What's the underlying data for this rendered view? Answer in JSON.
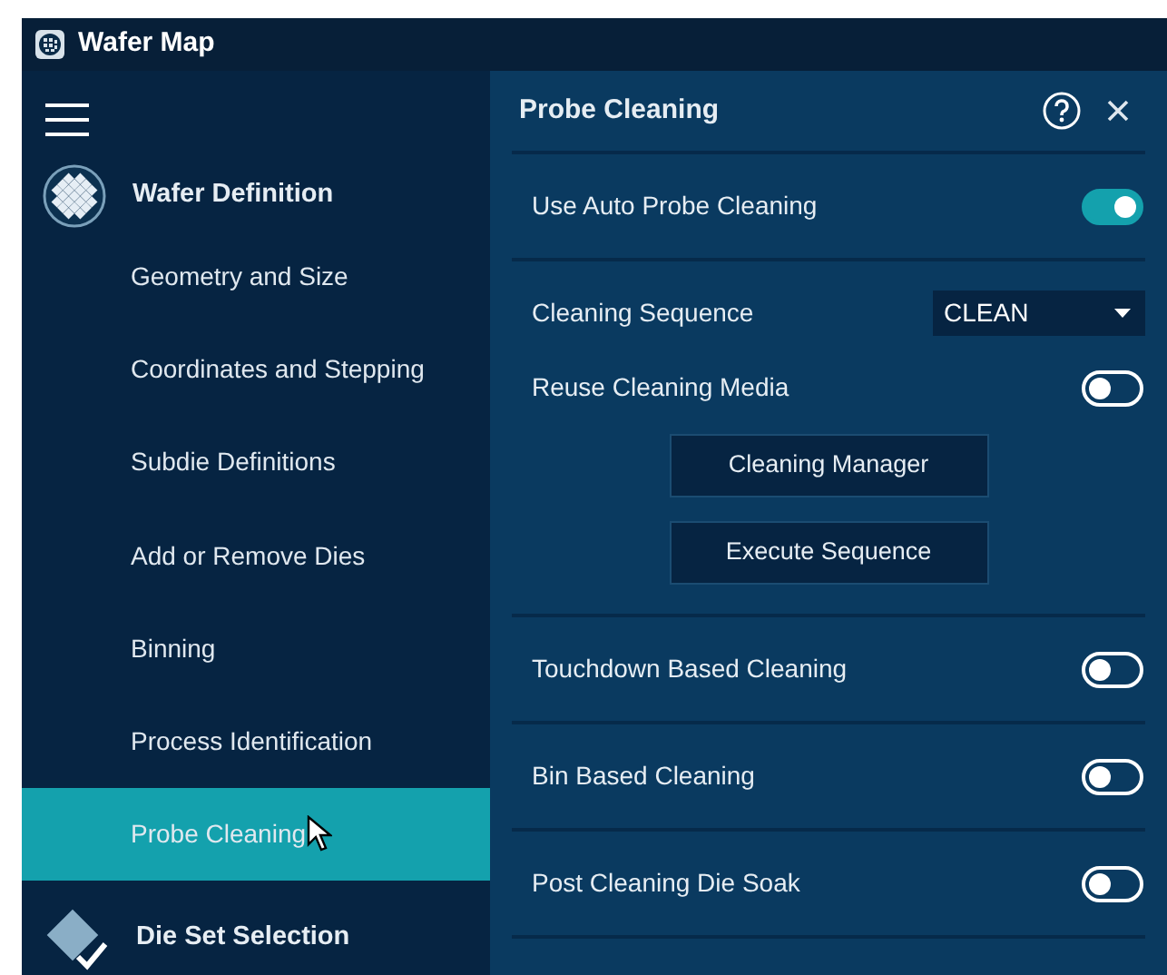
{
  "window": {
    "title": "Wafer Map"
  },
  "sidebar": {
    "sections": [
      {
        "label": "Wafer Definition",
        "kind": "wafer",
        "items": [
          {
            "label": "Geometry and Size",
            "selected": false
          },
          {
            "label": "Coordinates and Stepping",
            "selected": false
          },
          {
            "label": "Subdie Definitions",
            "selected": false
          },
          {
            "label": "Add or Remove Dies",
            "selected": false
          },
          {
            "label": "Binning",
            "selected": false
          },
          {
            "label": "Process Identification",
            "selected": false
          },
          {
            "label": "Probe Cleaning",
            "selected": true
          }
        ]
      },
      {
        "label": "Die Set Selection",
        "kind": "die-set"
      }
    ]
  },
  "panel": {
    "title": "Probe Cleaning",
    "groups": [
      [
        {
          "kind": "toggle",
          "label": "Use Auto Probe Cleaning",
          "on": true
        }
      ],
      [
        {
          "kind": "select",
          "label": "Cleaning Sequence",
          "value": "CLEAN"
        },
        {
          "kind": "toggle",
          "label": "Reuse Cleaning Media",
          "on": false
        },
        {
          "kind": "button",
          "label": "Cleaning Manager"
        },
        {
          "kind": "button",
          "label": "Execute Sequence"
        }
      ],
      [
        {
          "kind": "toggle",
          "label": "Touchdown Based Cleaning",
          "on": false
        }
      ],
      [
        {
          "kind": "toggle",
          "label": "Bin Based Cleaning",
          "on": false
        }
      ],
      [
        {
          "kind": "toggle",
          "label": "Post Cleaning Die Soak",
          "on": false
        }
      ]
    ]
  }
}
